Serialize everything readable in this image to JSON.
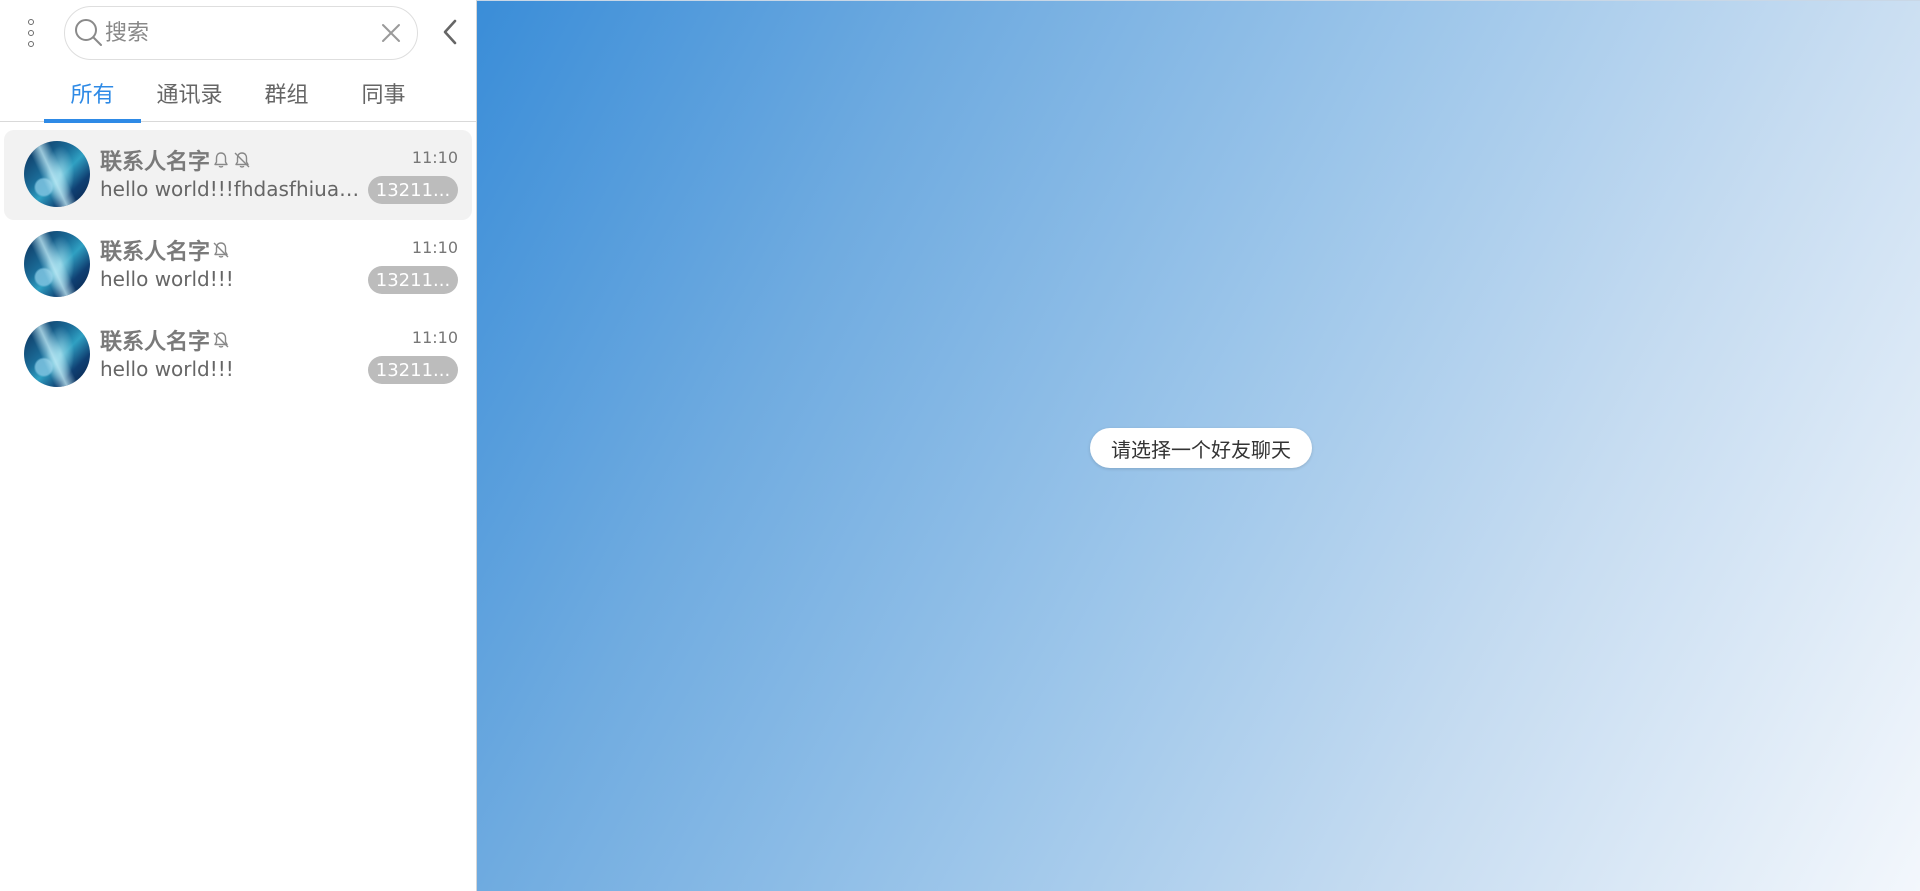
{
  "search": {
    "placeholder": "搜索"
  },
  "tabs": [
    {
      "label": "所有",
      "active": true
    },
    {
      "label": "通讯录",
      "active": false
    },
    {
      "label": "群组",
      "active": false
    },
    {
      "label": "同事",
      "active": false
    }
  ],
  "conversations": [
    {
      "name": "联系人名字",
      "icons": [
        "bell-icon",
        "bell-off-icon"
      ],
      "time": "11:10",
      "preview": "hello world!!!fhdasfhiuas...",
      "badge": "13211...",
      "selected": true
    },
    {
      "name": "联系人名字",
      "icons": [
        "bell-off-icon"
      ],
      "time": "11:10",
      "preview": "hello world!!!",
      "badge": "13211...",
      "selected": false
    },
    {
      "name": "联系人名字",
      "icons": [
        "bell-off-icon"
      ],
      "time": "11:10",
      "preview": "hello world!!!",
      "badge": "13211...",
      "selected": false
    }
  ],
  "main": {
    "hint": "请选择一个好友聊天"
  },
  "colors": {
    "accent": "#2e8ae6",
    "badge_bg": "#bcbcbc",
    "selected_bg": "#f2f2f2"
  }
}
